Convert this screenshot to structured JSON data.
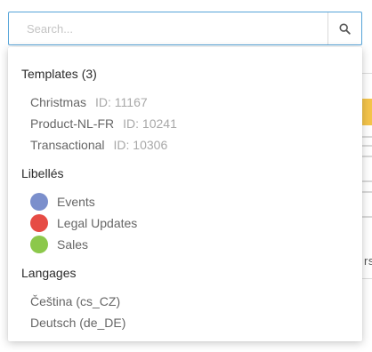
{
  "search": {
    "placeholder": "Search..."
  },
  "sections": {
    "templates": {
      "title": "Templates (3)",
      "items": [
        {
          "name": "Christmas",
          "id": "ID: 11167"
        },
        {
          "name": "Product-NL-FR",
          "id": "ID: 10241"
        },
        {
          "name": "Transactional",
          "id": "ID: 10306"
        }
      ]
    },
    "labels": {
      "title": "Libellés",
      "items": [
        {
          "name": "Events",
          "color": "#7b8fcc"
        },
        {
          "name": "Legal Updates",
          "color": "#e64c45"
        },
        {
          "name": "Sales",
          "color": "#8cc84b"
        }
      ]
    },
    "languages": {
      "title": "Langages",
      "items": [
        {
          "name": "Čeština (cs_CZ)"
        },
        {
          "name": "Deutsch (de_DE)"
        }
      ]
    }
  },
  "background": {
    "peek_text": "rs"
  }
}
